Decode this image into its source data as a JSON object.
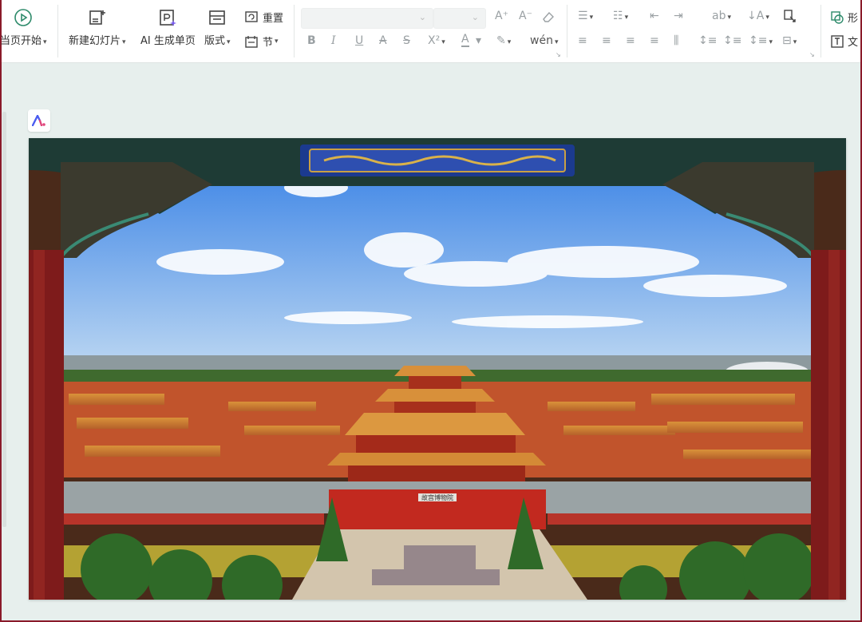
{
  "ribbon": {
    "slideshow": {
      "label": "当页开始"
    },
    "new_slide": {
      "label": "新建幻灯片"
    },
    "ai_page": {
      "label": "AI 生成单页"
    },
    "layout": {
      "label": "版式"
    },
    "reset": {
      "label": "重置"
    },
    "section": {
      "label": "节"
    },
    "shape": {
      "label": "形"
    },
    "textbox": {
      "label": "文"
    },
    "font_name": {
      "value": ""
    },
    "font_size": {
      "value": ""
    }
  },
  "slide": {
    "image_subject": "forbidden-city-view-through-ornate-gate",
    "sign_text": "故宫博物院"
  },
  "colors": {
    "accent": "#8a1a2a",
    "workspace_bg": "#e7efed",
    "ribbon_bg": "#ffffff"
  }
}
